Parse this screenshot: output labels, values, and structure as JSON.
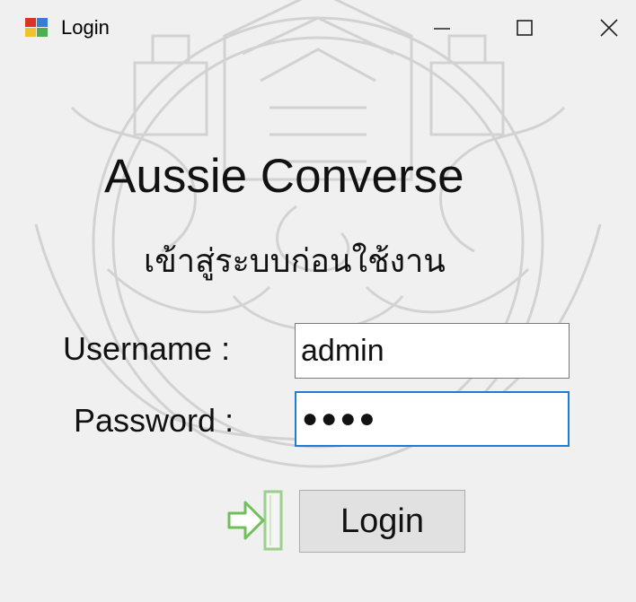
{
  "window": {
    "title": "Login",
    "controls": {
      "minimize_icon": "minimize-icon",
      "maximize_icon": "maximize-icon",
      "close_icon": "close-icon"
    }
  },
  "header": {
    "app_name": "Aussie Converse",
    "subtitle": "เข้าสู่ระบบก่อนใช้งาน"
  },
  "form": {
    "username_label": "Username :",
    "username_value": "admin",
    "password_label": "Password :",
    "password_value": "●●●●"
  },
  "actions": {
    "login_icon": "login-arrow-icon",
    "login_label": "Login"
  },
  "colors": {
    "background": "#f0f0f0",
    "focus_border": "#1e7bd6",
    "button_bg": "#e1e1e1",
    "icon_green": "#6fbf5a"
  }
}
